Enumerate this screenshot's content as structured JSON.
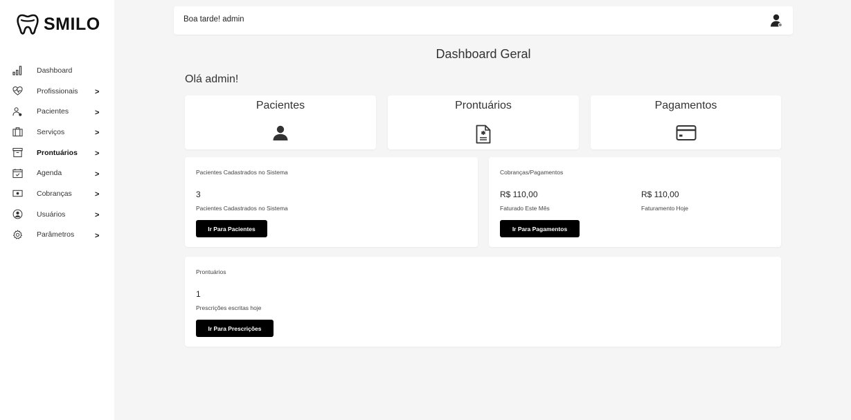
{
  "brand": {
    "name": "SMILO"
  },
  "sidebar": {
    "items": [
      {
        "label": "Dashboard",
        "icon": "bar-chart-icon",
        "chevron": ""
      },
      {
        "label": "Profissionais",
        "icon": "heartbeat-icon",
        "chevron": ">"
      },
      {
        "label": "Pacientes",
        "icon": "users-icon",
        "chevron": ">"
      },
      {
        "label": "Serviços",
        "icon": "briefcase-icon",
        "chevron": ">"
      },
      {
        "label": "Prontuários",
        "icon": "archive-icon",
        "chevron": ">",
        "active": true
      },
      {
        "label": "Agenda",
        "icon": "calendar-icon",
        "chevron": ">"
      },
      {
        "label": "Cobranças",
        "icon": "money-icon",
        "chevron": ">"
      },
      {
        "label": "Usuários",
        "icon": "user-circle-icon",
        "chevron": ">"
      },
      {
        "label": "Parâmetros",
        "icon": "gear-icon",
        "chevron": ">"
      }
    ]
  },
  "header": {
    "greeting": "Boa tarde! admin"
  },
  "main": {
    "title": "Dashboard Geral",
    "hello": "Olá admin!",
    "tiles": [
      {
        "title": "Pacientes",
        "icon": "user-icon"
      },
      {
        "title": "Prontuários",
        "icon": "medical-document-icon"
      },
      {
        "title": "Pagamentos",
        "icon": "credit-card-icon"
      }
    ],
    "patients_card": {
      "heading": "Pacientes Cadastrados no Sistema",
      "value": "3",
      "caption": "Pacientes Cadastrados no Sistema",
      "button": "Ir Para Pacientes"
    },
    "billing_card": {
      "heading": "Cobranças/Pagamentos",
      "month_value": "R$ 110,00",
      "month_caption": "Faturado Este Mês",
      "today_value": "R$ 110,00",
      "today_caption": "Faturamento Hoje",
      "button": "Ir Para Pagamentos"
    },
    "records_card": {
      "heading": "Prontuários",
      "value": "1",
      "caption": "Prescrições escritas hoje",
      "button": "Ir Para Prescrições"
    }
  },
  "colors": {
    "background": "#f5f5f5",
    "card": "#ffffff",
    "button": "#000000",
    "text": "#333333"
  }
}
